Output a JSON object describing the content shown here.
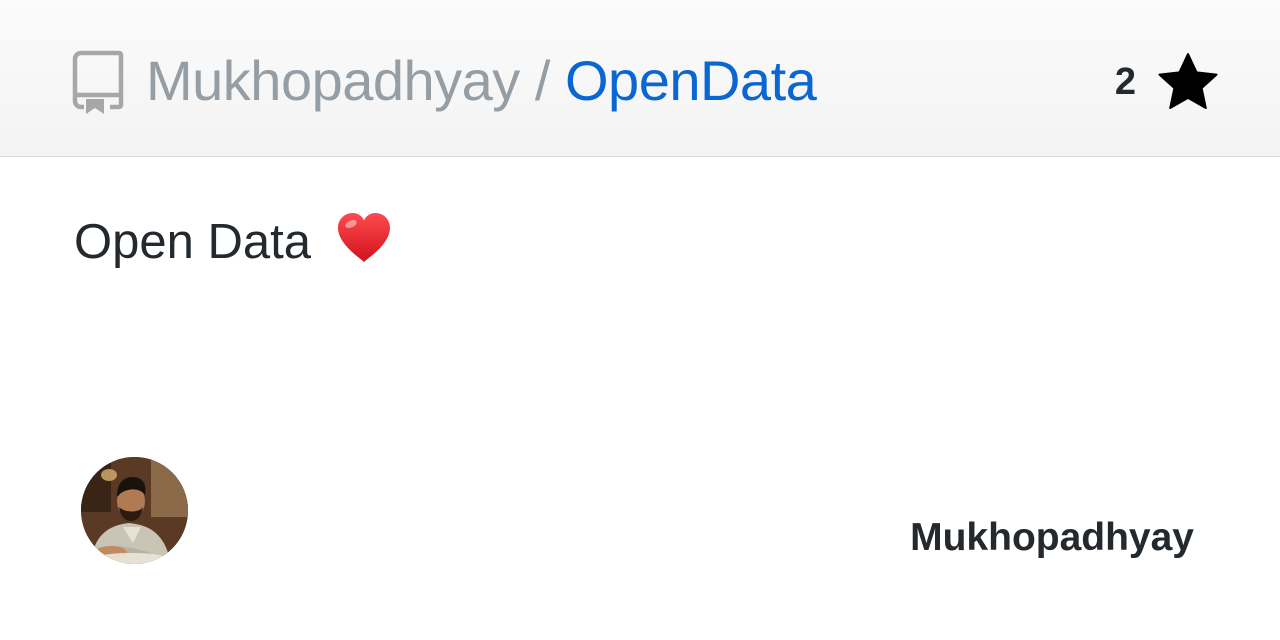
{
  "repo": {
    "owner": "Mukhopadhyay",
    "separator": " / ",
    "name": "OpenData",
    "description": "Open Data",
    "stars": "2"
  },
  "author": {
    "name": "Mukhopadhyay"
  },
  "icons": {
    "repo": "repo-icon",
    "star": "star-icon",
    "heart": "red-heart-emoji",
    "avatar": "avatar-photo"
  },
  "colors": {
    "owner": "#959da5",
    "repo_name": "#0a66d2",
    "text": "#24292e",
    "heart": "#e0202a"
  }
}
